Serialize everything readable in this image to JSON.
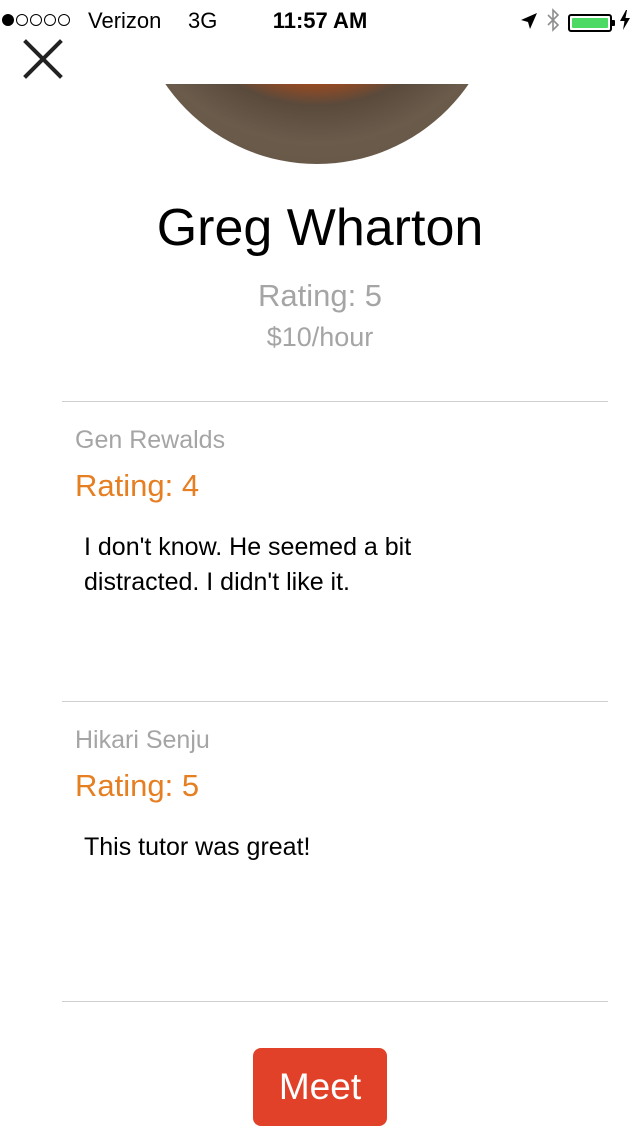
{
  "status_bar": {
    "carrier": "Verizon",
    "network": "3G",
    "time": "11:57 AM",
    "signal_strength": 1,
    "signal_max": 5,
    "battery_level": 1.0,
    "battery_color": "#4cd964",
    "icons": [
      "location-arrow-icon",
      "bluetooth-icon",
      "battery-icon",
      "charging-bolt-icon"
    ]
  },
  "close_button": {
    "icon": "close-icon"
  },
  "profile": {
    "name": "Greg Wharton",
    "rating": "Rating: 5",
    "rate": "$10/hour"
  },
  "reviews": [
    {
      "author": "Gen Rewalds",
      "rating": "Rating: 4",
      "text": "I don't know. He seemed a bit distracted. I didn't like it."
    },
    {
      "author": "Hikari Senju",
      "rating": "Rating: 5",
      "text": "This tutor was great!"
    }
  ],
  "actions": {
    "meet_label": "Meet"
  },
  "colors": {
    "accent_orange": "#e67e22",
    "meet_button": "#e14129",
    "muted_text": "#a5a5a5"
  }
}
